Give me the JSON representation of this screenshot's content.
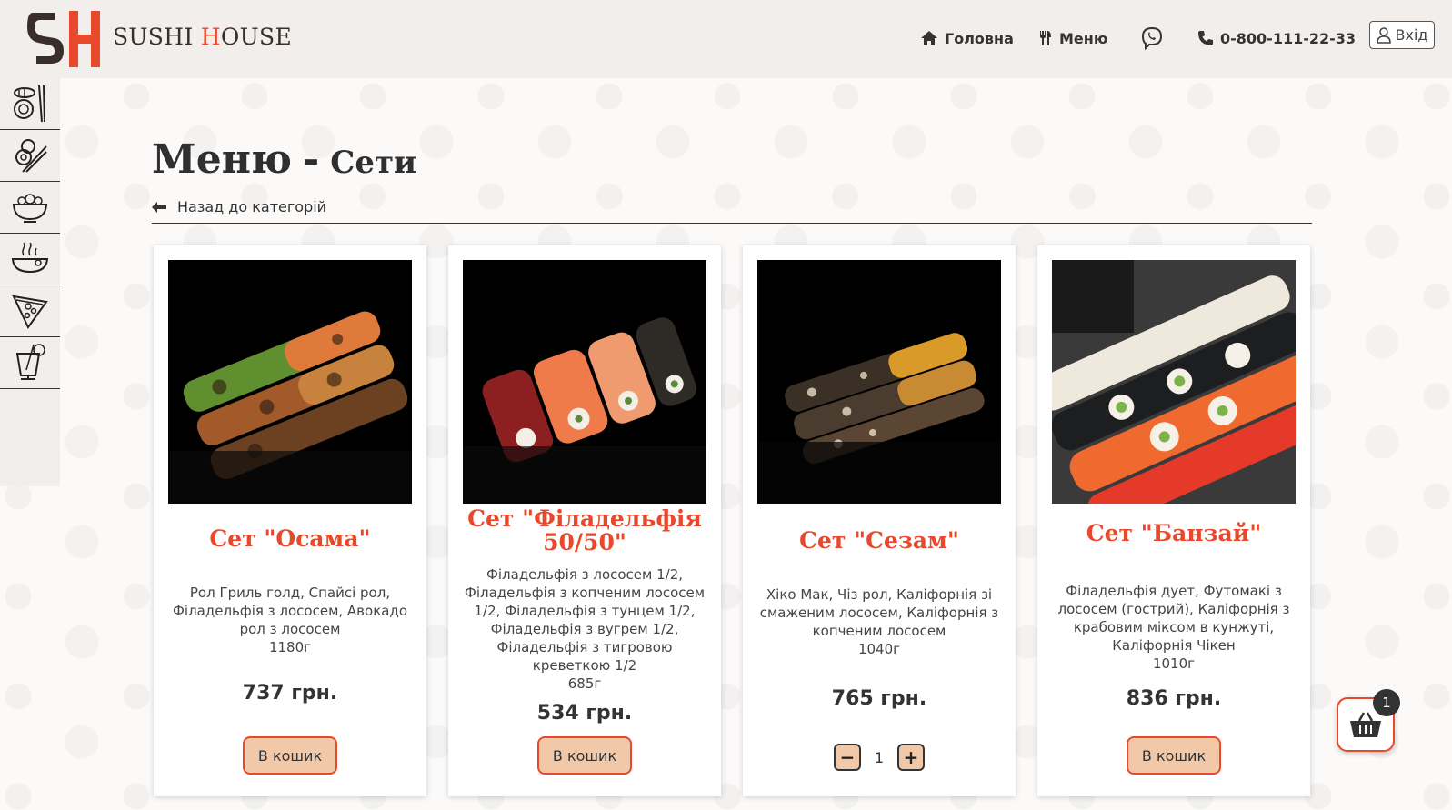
{
  "brand": {
    "name_main": "SUSHI ",
    "name_accent": "H",
    "name_rest": "OUSE",
    "accent_color": "#e8492c"
  },
  "nav": {
    "home": "Головна",
    "menu": "Меню",
    "phone": "0-800-111-22-33",
    "login": "Вхід"
  },
  "sidebar": {
    "items": [
      {
        "icon": "sushi-roll-icon"
      },
      {
        "icon": "rolls-chopsticks-icon"
      },
      {
        "icon": "salad-bowl-icon"
      },
      {
        "icon": "hot-dish-icon"
      },
      {
        "icon": "pizza-slice-icon"
      },
      {
        "icon": "cocktail-icon"
      }
    ]
  },
  "page": {
    "title": "Меню",
    "separator": "-",
    "subtitle": "Сети",
    "back_label": "Назад до категорій"
  },
  "products": [
    {
      "title": "Сет \"Осама\"",
      "description": "Рол Гриль голд, Спайсі рол, Філадельфія з лососем, Авокадо рол з лососем",
      "weight": "1180г",
      "price": "737 грн.",
      "button": "В кошик"
    },
    {
      "title": "Сет \"Філадельфія 50/50\"",
      "description": "Філадельфія з лососем 1/2, Філадельфія з копченим лососем 1/2, Філадельфія з тунцем 1/2, Філадельфія з вугрем 1/2, Філадельфія з тигровою креветкою 1/2",
      "weight": "685г",
      "price": "534 грн.",
      "button": "В кошик"
    },
    {
      "title": "Сет \"Сезам\"",
      "description": "Хіко Мак, Чіз рол, Каліфорнія зі смаженим лососем, Каліфорнія з копченим лососем",
      "weight": "1040г",
      "price": "765 грн.",
      "quantity": "1",
      "minus": "−",
      "plus": "+"
    },
    {
      "title": "Сет \"Банзай\"",
      "description": "Філадельфія дует, Футомакі з лососем (гострий), Каліфорнія з крабовим міксом в кунжуті, Каліфорнія Чікен",
      "weight": "1010г",
      "price": "836 грн.",
      "button": "В кошик"
    }
  ],
  "cart": {
    "count": "1"
  }
}
